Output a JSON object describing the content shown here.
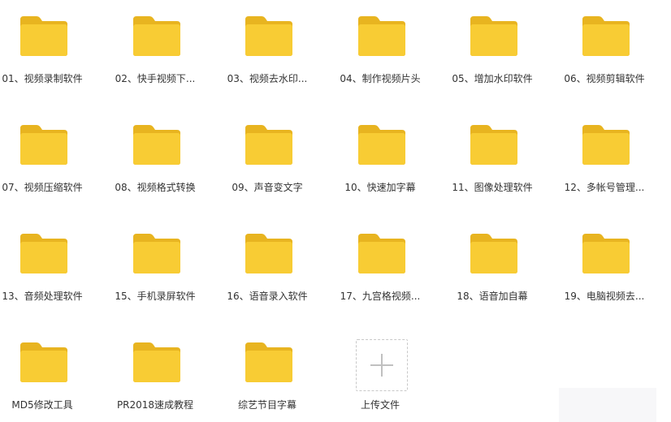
{
  "folders": [
    {
      "label": "01、视频录制软件"
    },
    {
      "label": "02、快手视频下..."
    },
    {
      "label": "03、视频去水印..."
    },
    {
      "label": "04、制作视频片头"
    },
    {
      "label": "05、增加水印软件"
    },
    {
      "label": "06、视频剪辑软件"
    },
    {
      "label": "07、视频压缩软件"
    },
    {
      "label": "08、视频格式转换"
    },
    {
      "label": "09、声音变文字"
    },
    {
      "label": "10、快速加字幕"
    },
    {
      "label": "11、图像处理软件"
    },
    {
      "label": "12、多帐号管理..."
    },
    {
      "label": "13、音频处理软件"
    },
    {
      "label": "15、手机录屏软件"
    },
    {
      "label": "16、语音录入软件"
    },
    {
      "label": "17、九宫格视频..."
    },
    {
      "label": "18、语音加自幕"
    },
    {
      "label": "19、电脑视频去..."
    },
    {
      "label": "MD5修改工具"
    },
    {
      "label": "PR2018速成教程"
    },
    {
      "label": "综艺节目字幕"
    }
  ],
  "upload": {
    "label": "上传文件",
    "icon": "plus-icon"
  },
  "colors": {
    "folder_body": "#F8CC34",
    "folder_tab": "#E8B420",
    "text": "#333333",
    "dashed_border": "#C8C8C8"
  }
}
